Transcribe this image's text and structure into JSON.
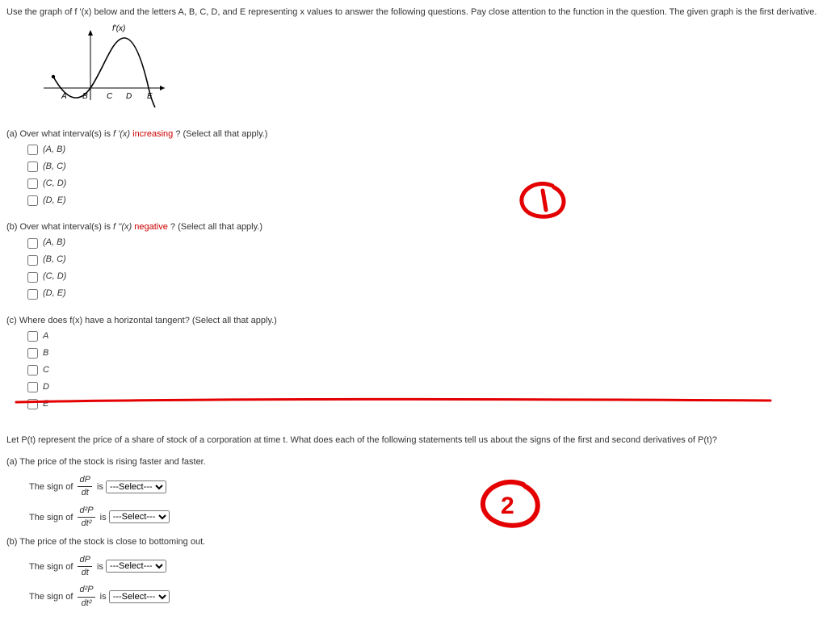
{
  "intro": "Use the graph of f '(x) below and the letters A, B, C, D, and E representing x values to answer the following questions. Pay close attention to the function in the question. The given graph is the first derivative.",
  "graphTitle": "f'(x)",
  "xlabels": [
    "A",
    "B",
    "C",
    "D",
    "E"
  ],
  "partA": {
    "prompt_pre": "(a) Over what interval(s) is ",
    "func": "f '(x)",
    "keyword": "increasing",
    "prompt_post": "? (Select all that apply.)",
    "options": [
      "(A, B)",
      "(B, C)",
      "(C, D)",
      "(D, E)"
    ]
  },
  "partB": {
    "prompt_pre": "(b) Over what interval(s) is ",
    "func": "f ''(x)",
    "keyword": "negative",
    "prompt_post": "? (Select all that apply.)",
    "options": [
      "(A, B)",
      "(B, C)",
      "(C, D)",
      "(D, E)"
    ]
  },
  "partC": {
    "prompt": "(c) Where does f(x) have a horizontal tangent? (Select all that apply.)",
    "options": [
      "A",
      "B",
      "C",
      "D",
      "E"
    ]
  },
  "q2intro": "Let P(t) represent the price of a share of stock of a corporation at time t. What does each of the following statements tell us about the signs of the first and second derivatives of P(t)?",
  "q2a": {
    "label": "(a) The price of the stock is rising faster and faster."
  },
  "q2b": {
    "label": "(b) The price of the stock is close to bottoming out."
  },
  "signPre": "The sign of",
  "isWord": "is",
  "deriv1_num": "dP",
  "deriv1_den": "dt",
  "deriv2_num": "d²P",
  "deriv2_den": "dt²",
  "selectPlaceholder": "---Select---"
}
